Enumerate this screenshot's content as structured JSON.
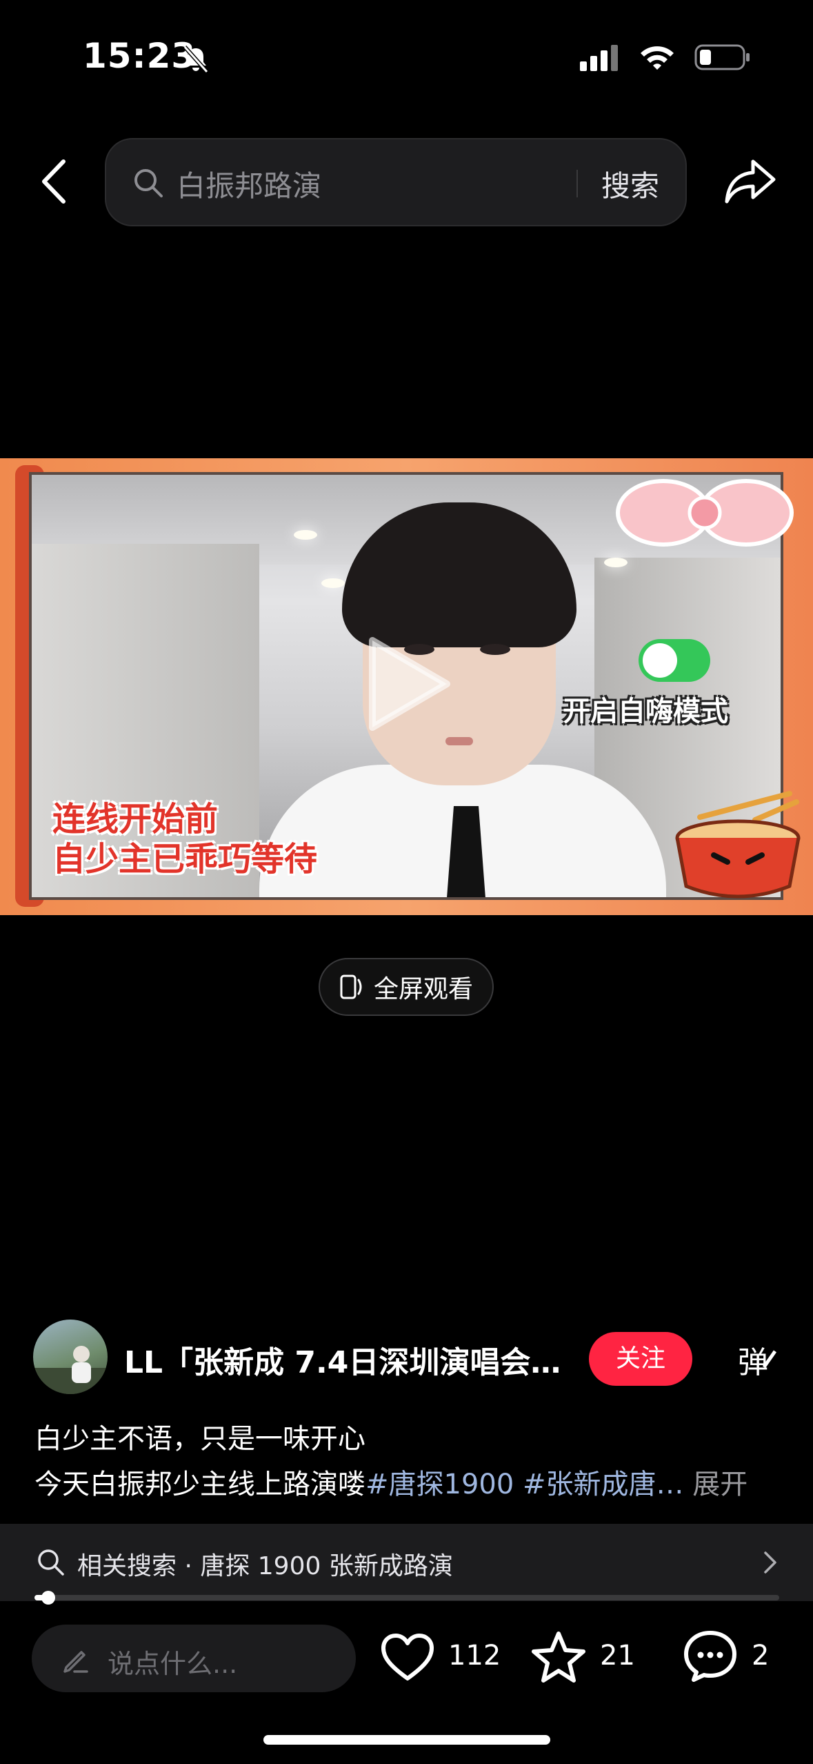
{
  "status_bar": {
    "time": "15:23"
  },
  "search": {
    "placeholder": "白振邦路演",
    "button": "搜索"
  },
  "video": {
    "caption_left_1": "连线开始前",
    "caption_left_2": "自少主已乖巧等待",
    "caption_right": "开启自嗨模式"
  },
  "fullscreen": {
    "label": "全屏观看"
  },
  "author": {
    "name": "LL「张新成 7.4日深圳演唱会…",
    "follow": "关注",
    "danmu": "弹"
  },
  "description": {
    "line1": "白少主不语，只是一味开心",
    "line2_text": "今天白振邦少主线上路演喽",
    "line2_tags": "#唐探1900 #张新成唐…",
    "expand": "展开"
  },
  "related": {
    "label": "相关搜索 · 唐探 1900 张新成路演"
  },
  "progress": 0.02,
  "bottom": {
    "comment_placeholder": "说点什么...",
    "likes": "112",
    "stars": "21",
    "comments": "2"
  }
}
